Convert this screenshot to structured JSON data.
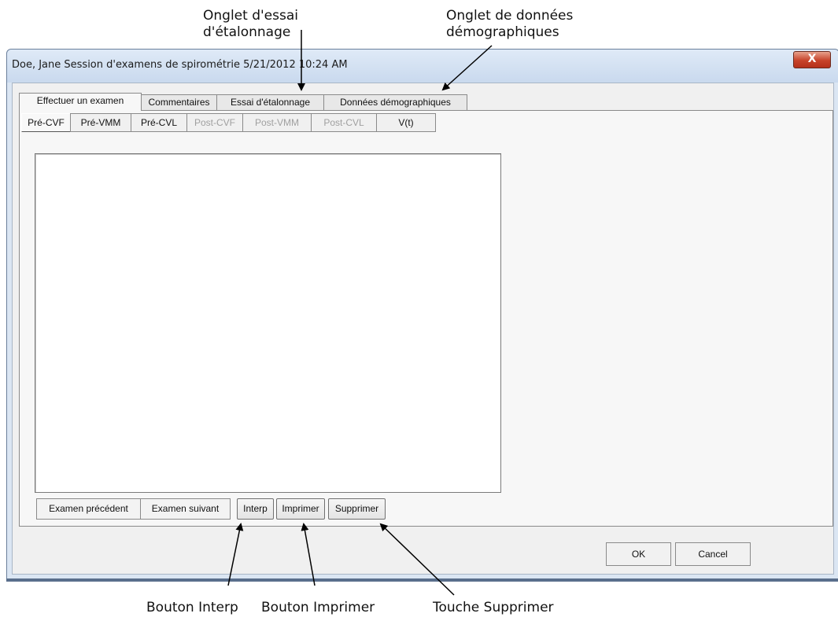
{
  "annotations": {
    "calibration_tab": [
      "Onglet d'essai",
      "d'étalonnage"
    ],
    "demographics_tab": [
      "Onglet de données",
      "démographiques"
    ],
    "interp_button": "Bouton Interp",
    "print_button": "Bouton Imprimer",
    "delete_key": "Touche Supprimer"
  },
  "window": {
    "title": "Doe, Jane Session d'examens de spirométrie 5/21/2012 10:24 AM",
    "close_glyph": "X"
  },
  "tabs": [
    "Effectuer un examen",
    "Commentaires",
    "Essai d'étalonnage",
    "Données démographiques"
  ],
  "subtabs": [
    {
      "label": "Pré-CVF",
      "enabled": true
    },
    {
      "label": "Pré-VMM",
      "enabled": true
    },
    {
      "label": "Pré-CVL",
      "enabled": true
    },
    {
      "label": "Post-CVF",
      "enabled": false
    },
    {
      "label": "Post-VMM",
      "enabled": false
    },
    {
      "label": "Post-CVL",
      "enabled": false
    },
    {
      "label": "V(t)",
      "enabled": true
    }
  ],
  "buttons": {
    "prev_exam": "Examen précédent",
    "next_exam": "Examen suivant",
    "interp": "Interp",
    "print": "Imprimer",
    "delete": "Supprimer",
    "ok": "OK",
    "cancel": "Cancel"
  }
}
